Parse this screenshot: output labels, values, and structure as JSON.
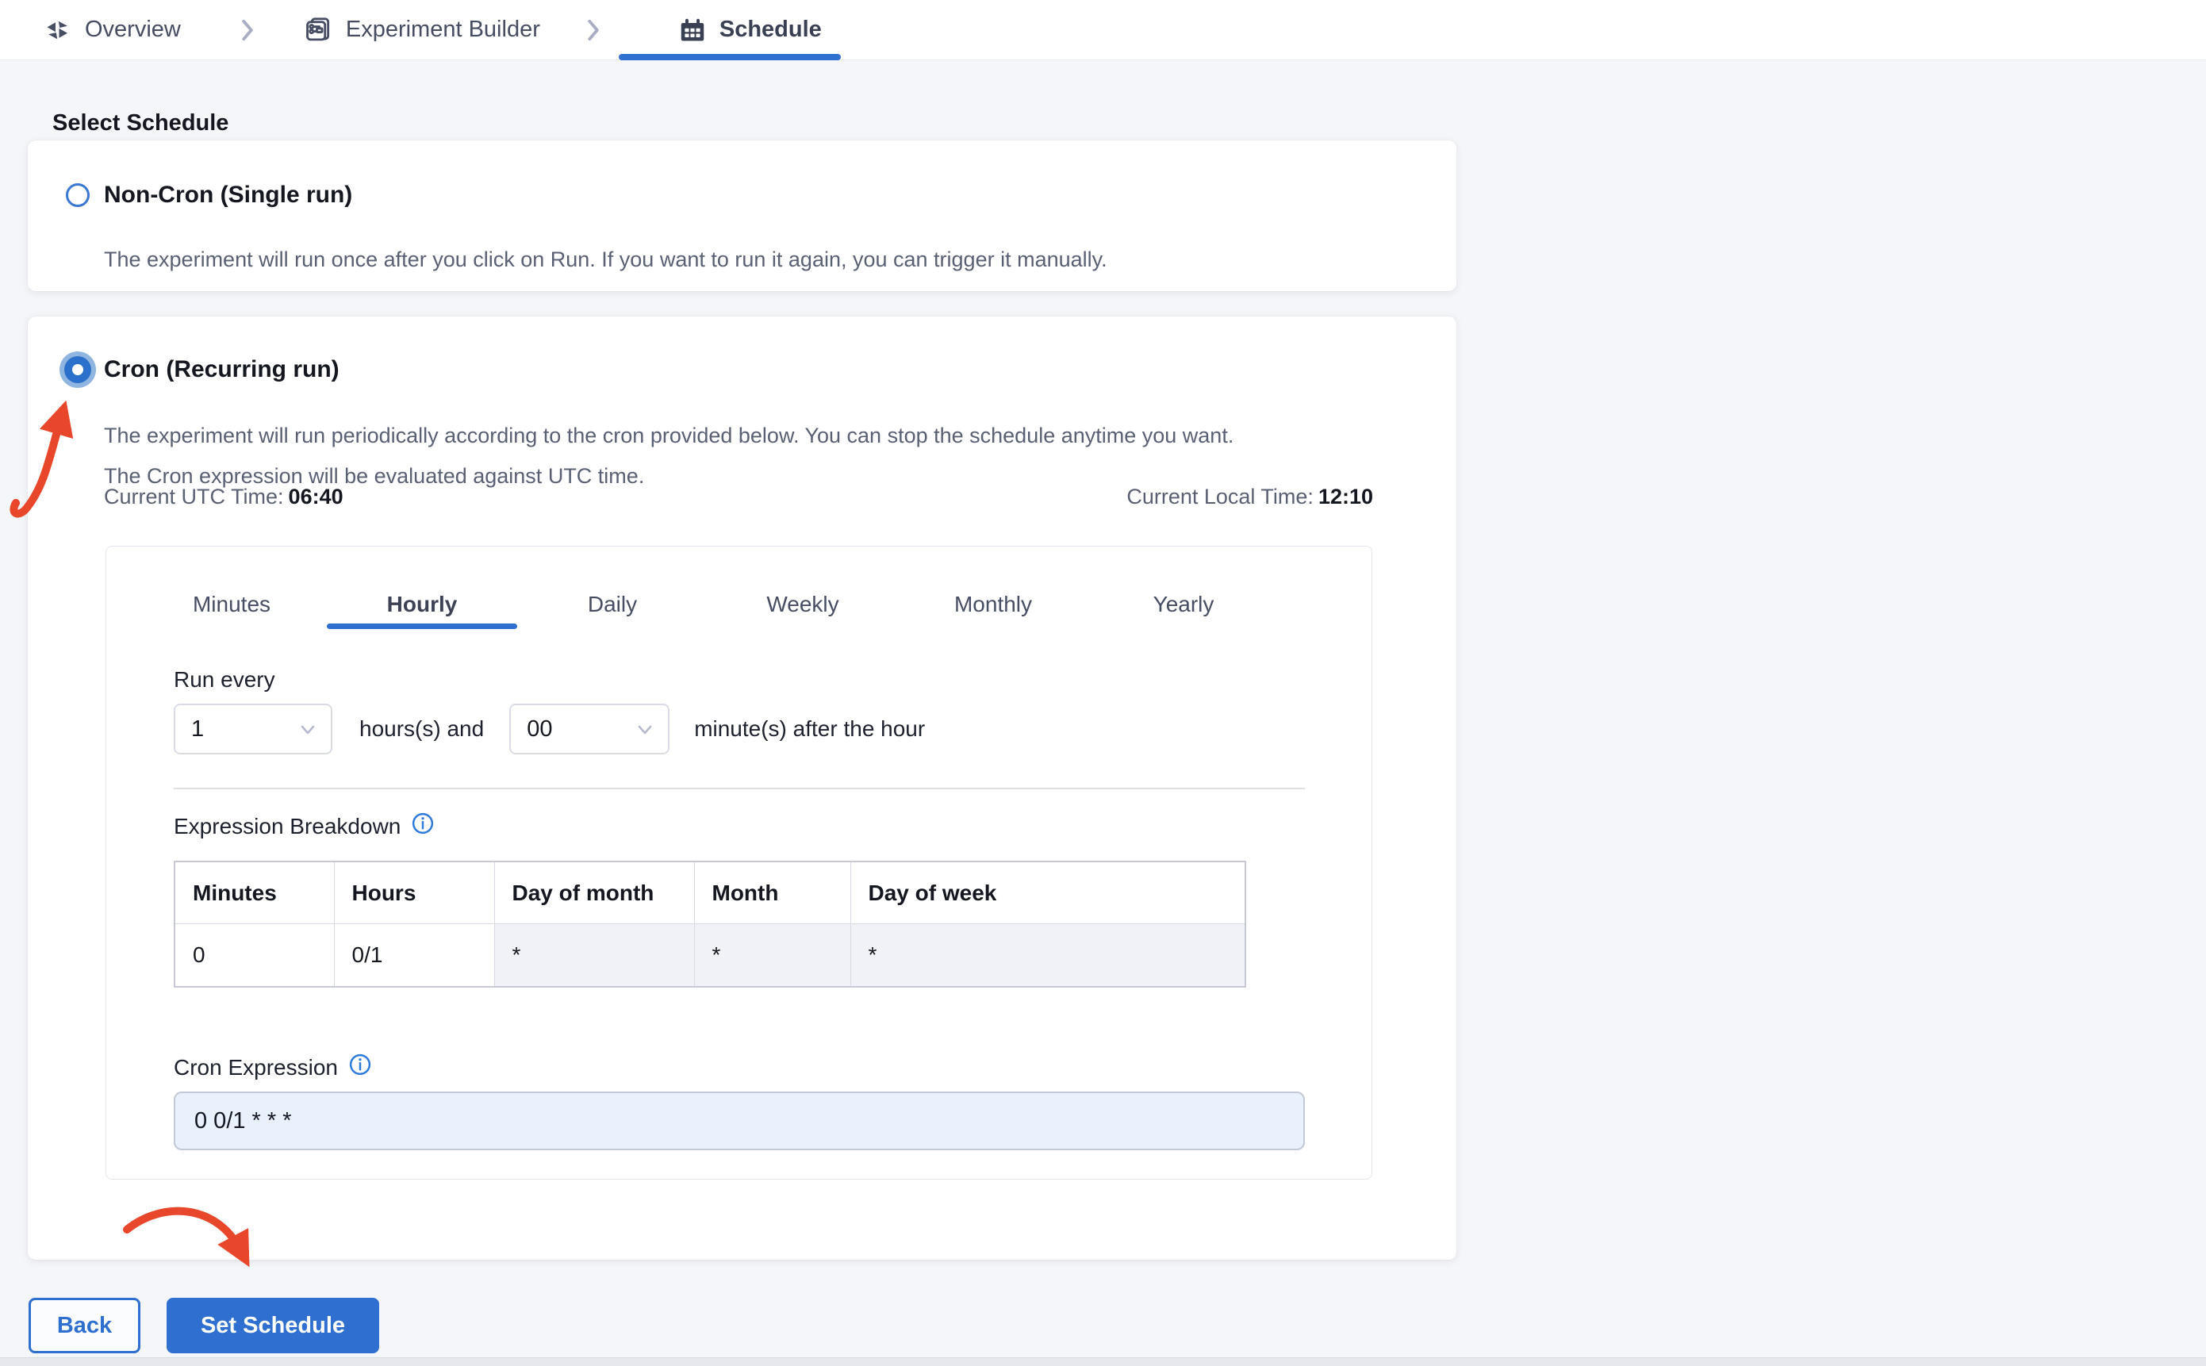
{
  "breadcrumb": {
    "items": [
      {
        "label": "Overview",
        "icon": "overview-icon"
      },
      {
        "label": "Experiment Builder",
        "icon": "experiment-builder-icon"
      },
      {
        "label": "Schedule",
        "icon": "calendar-icon",
        "active": true
      }
    ]
  },
  "page": {
    "title": "Select Schedule"
  },
  "options": {
    "non_cron": {
      "selected": false,
      "title": "Non-Cron (Single run)",
      "description": "The experiment will run once after you click on Run. If you want to run it again, you can trigger it manually."
    },
    "cron": {
      "selected": true,
      "title": "Cron (Recurring run)",
      "description_line1": "The experiment will run periodically according to the cron provided below. You can stop the schedule anytime you want.",
      "description_line2": "The Cron expression will be evaluated against UTC time.",
      "utc_label": "Current UTC Time:",
      "utc_value": "06:40",
      "local_label": "Current Local Time:",
      "local_value": "12:10"
    }
  },
  "cron_panel": {
    "tabs": [
      "Minutes",
      "Hourly",
      "Daily",
      "Weekly",
      "Monthly",
      "Yearly"
    ],
    "active_tab": "Hourly",
    "run_every_label": "Run every",
    "hours_value": "1",
    "hours_suffix": "hours(s) and",
    "minutes_value": "00",
    "minutes_suffix": "minute(s) after the hour",
    "breakdown": {
      "label": "Expression Breakdown",
      "headers": [
        "Minutes",
        "Hours",
        "Day of month",
        "Month",
        "Day of week"
      ],
      "values": [
        "0",
        "0/1",
        "*",
        "*",
        "*"
      ]
    },
    "expression": {
      "label": "Cron Expression",
      "value": "0 0/1 * * *"
    }
  },
  "footer": {
    "back_label": "Back",
    "submit_label": "Set Schedule"
  },
  "colors": {
    "accent": "#2e6fd0",
    "annotation_arrow": "#e8472b",
    "radio_halo": "#8fb5e0"
  }
}
